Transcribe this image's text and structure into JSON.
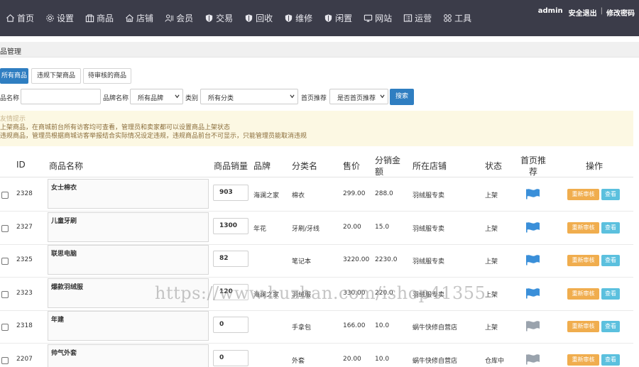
{
  "nav": {
    "items": [
      {
        "label": "首页",
        "icon": "home-icon"
      },
      {
        "label": "设置",
        "icon": "gear-icon"
      },
      {
        "label": "商品",
        "icon": "goods-icon"
      },
      {
        "label": "店铺",
        "icon": "store-icon"
      },
      {
        "label": "会员",
        "icon": "member-icon"
      },
      {
        "label": "交易",
        "icon": "shield-icon"
      },
      {
        "label": "回收",
        "icon": "shield-icon"
      },
      {
        "label": "维修",
        "icon": "shield-icon"
      },
      {
        "label": "闲置",
        "icon": "shield-icon"
      },
      {
        "label": "网站",
        "icon": "monitor-icon"
      },
      {
        "label": "运营",
        "icon": "operation-icon"
      },
      {
        "label": "工具",
        "icon": "tools-icon"
      }
    ],
    "user": "admin",
    "logout": "安全退出",
    "change_password": "修改密码",
    "separator": "|"
  },
  "section": {
    "title": "品管理"
  },
  "tabs": [
    "所有商品",
    "违规下架商品",
    "待审核的商品"
  ],
  "filters": {
    "name_label": "品名称",
    "brand_label": "品牌名称",
    "brand_value": "所有品牌",
    "category_label": "类别",
    "category_value": "所有分类",
    "recommend_label": "首页推荐",
    "recommend_value": "是否首页推荐",
    "search_button": "搜索"
  },
  "notice": {
    "title": "友情提示",
    "line1": "上架商品，在商城前台所有访客均可查看，管理员和卖家都可以设置商品上架状态",
    "line2": "违规商品，管理员根据商城访客举报结合实际情况设定违规，违规商品前台不可显示，只能管理员能取消违规"
  },
  "table": {
    "headers": {
      "id": "ID",
      "name": "商品名称",
      "sales": "商品销量",
      "brand": "品牌",
      "category": "分类名",
      "price": "售价",
      "commission_1": "分销金",
      "commission_2": "额",
      "store": "所在店铺",
      "status": "状态",
      "recommend_1": "首页推",
      "recommend_2": "荐",
      "actions": "操作"
    },
    "rows": [
      {
        "id": "2328",
        "name": "女士棉衣",
        "sales": "903",
        "brand": "海澜之家",
        "category": "棉衣",
        "price": "299.00",
        "commission": "288.0",
        "store": "羽绒服专卖",
        "status": "上架",
        "flag": "blue"
      },
      {
        "id": "2327",
        "name": "儿童牙刷",
        "sales": "1300",
        "brand": "年花",
        "category": "牙刷/牙线",
        "price": "20.00",
        "commission": "15.0",
        "store": "羽绒服专卖",
        "status": "上架",
        "flag": "blue"
      },
      {
        "id": "2325",
        "name": "联思电脑",
        "sales": "82",
        "brand": "",
        "category": "笔记本",
        "price": "3220.00",
        "commission": "2230.0",
        "store": "羽绒服专卖",
        "status": "上架",
        "flag": "blue"
      },
      {
        "id": "2323",
        "name": "爆款羽绒服",
        "sales": "120",
        "brand": "海澜之家",
        "category": "羽绒服",
        "price": "330.00",
        "commission": "220.0",
        "store": "羽绒服专卖",
        "status": "上架",
        "flag": "blue"
      },
      {
        "id": "2318",
        "name": "年建",
        "sales": "0",
        "brand": "",
        "category": "手拿包",
        "price": "166.00",
        "commission": "10.0",
        "store": "蜗牛快修自营店",
        "status": "上架",
        "flag": "gray"
      },
      {
        "id": "2207",
        "name": "帅气外套",
        "sales": "0",
        "brand": "",
        "category": "外套",
        "price": "20.00",
        "commission": "10.0",
        "store": "蜗牛快修自营店",
        "status": "仓库中",
        "flag": "gray"
      }
    ],
    "review_button": "重新审核",
    "view_button": "查看"
  },
  "colors": {
    "nav_bg": "#3b3c49",
    "primary": "#2f7ec1",
    "warning": "#f0ad4e",
    "info": "#5bc0de",
    "flag_blue": "#3a8fd9",
    "flag_gray": "#9aa3ad",
    "notice_bg": "#fcf8e3"
  },
  "watermark": "https://www.huzhan.com/ishop41355"
}
